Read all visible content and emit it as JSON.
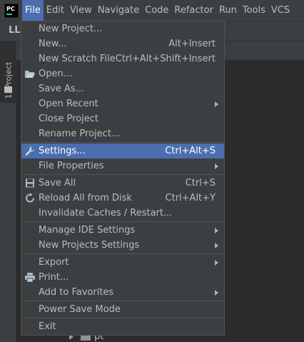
{
  "app": {
    "logo_text": "PC"
  },
  "menubar": {
    "items": [
      "File",
      "Edit",
      "View",
      "Navigate",
      "Code",
      "Refactor",
      "Run",
      "Tools",
      "VCS"
    ]
  },
  "background": {
    "project_label": "LLa",
    "side_tab": "1: Project",
    "tree_item": "pt"
  },
  "file_menu": {
    "items": [
      {
        "label": "New Project...",
        "shortcut": "",
        "submenu": false,
        "icon": ""
      },
      {
        "label": "New...",
        "shortcut": "Alt+Insert",
        "submenu": false,
        "icon": ""
      },
      {
        "label": "New Scratch File",
        "shortcut": "Ctrl+Alt+Shift+Insert",
        "submenu": false,
        "icon": ""
      },
      {
        "label": "Open...",
        "shortcut": "",
        "submenu": false,
        "icon": "folder-open-icon"
      },
      {
        "label": "Save As...",
        "shortcut": "",
        "submenu": false,
        "icon": ""
      },
      {
        "label": "Open Recent",
        "shortcut": "",
        "submenu": true,
        "icon": ""
      },
      {
        "label": "Close Project",
        "shortcut": "",
        "submenu": false,
        "icon": ""
      },
      {
        "label": "Rename Project...",
        "shortcut": "",
        "submenu": false,
        "icon": ""
      },
      {
        "label": "Settings...",
        "shortcut": "Ctrl+Alt+S",
        "submenu": false,
        "icon": "wrench-icon",
        "selected": true
      },
      {
        "label": "File Properties",
        "shortcut": "",
        "submenu": true,
        "icon": ""
      },
      {
        "label": "Save All",
        "shortcut": "Ctrl+S",
        "submenu": false,
        "icon": "save-icon"
      },
      {
        "label": "Reload All from Disk",
        "shortcut": "Ctrl+Alt+Y",
        "submenu": false,
        "icon": "reload-icon"
      },
      {
        "label": "Invalidate Caches / Restart...",
        "shortcut": "",
        "submenu": false,
        "icon": ""
      },
      {
        "label": "Manage IDE Settings",
        "shortcut": "",
        "submenu": true,
        "icon": ""
      },
      {
        "label": "New Projects Settings",
        "shortcut": "",
        "submenu": true,
        "icon": ""
      },
      {
        "label": "Export",
        "shortcut": "",
        "submenu": true,
        "icon": ""
      },
      {
        "label": "Print...",
        "shortcut": "",
        "submenu": false,
        "icon": "print-icon"
      },
      {
        "label": "Add to Favorites",
        "shortcut": "",
        "submenu": true,
        "icon": ""
      },
      {
        "label": "Power Save Mode",
        "shortcut": "",
        "submenu": false,
        "icon": ""
      },
      {
        "label": "Exit",
        "shortcut": "",
        "submenu": false,
        "icon": ""
      }
    ]
  },
  "colors": {
    "menu_bg": "#3c3f41",
    "selection": "#4b6eaf",
    "editor_bg": "#2b2b2b",
    "text": "#bbbbbb"
  }
}
